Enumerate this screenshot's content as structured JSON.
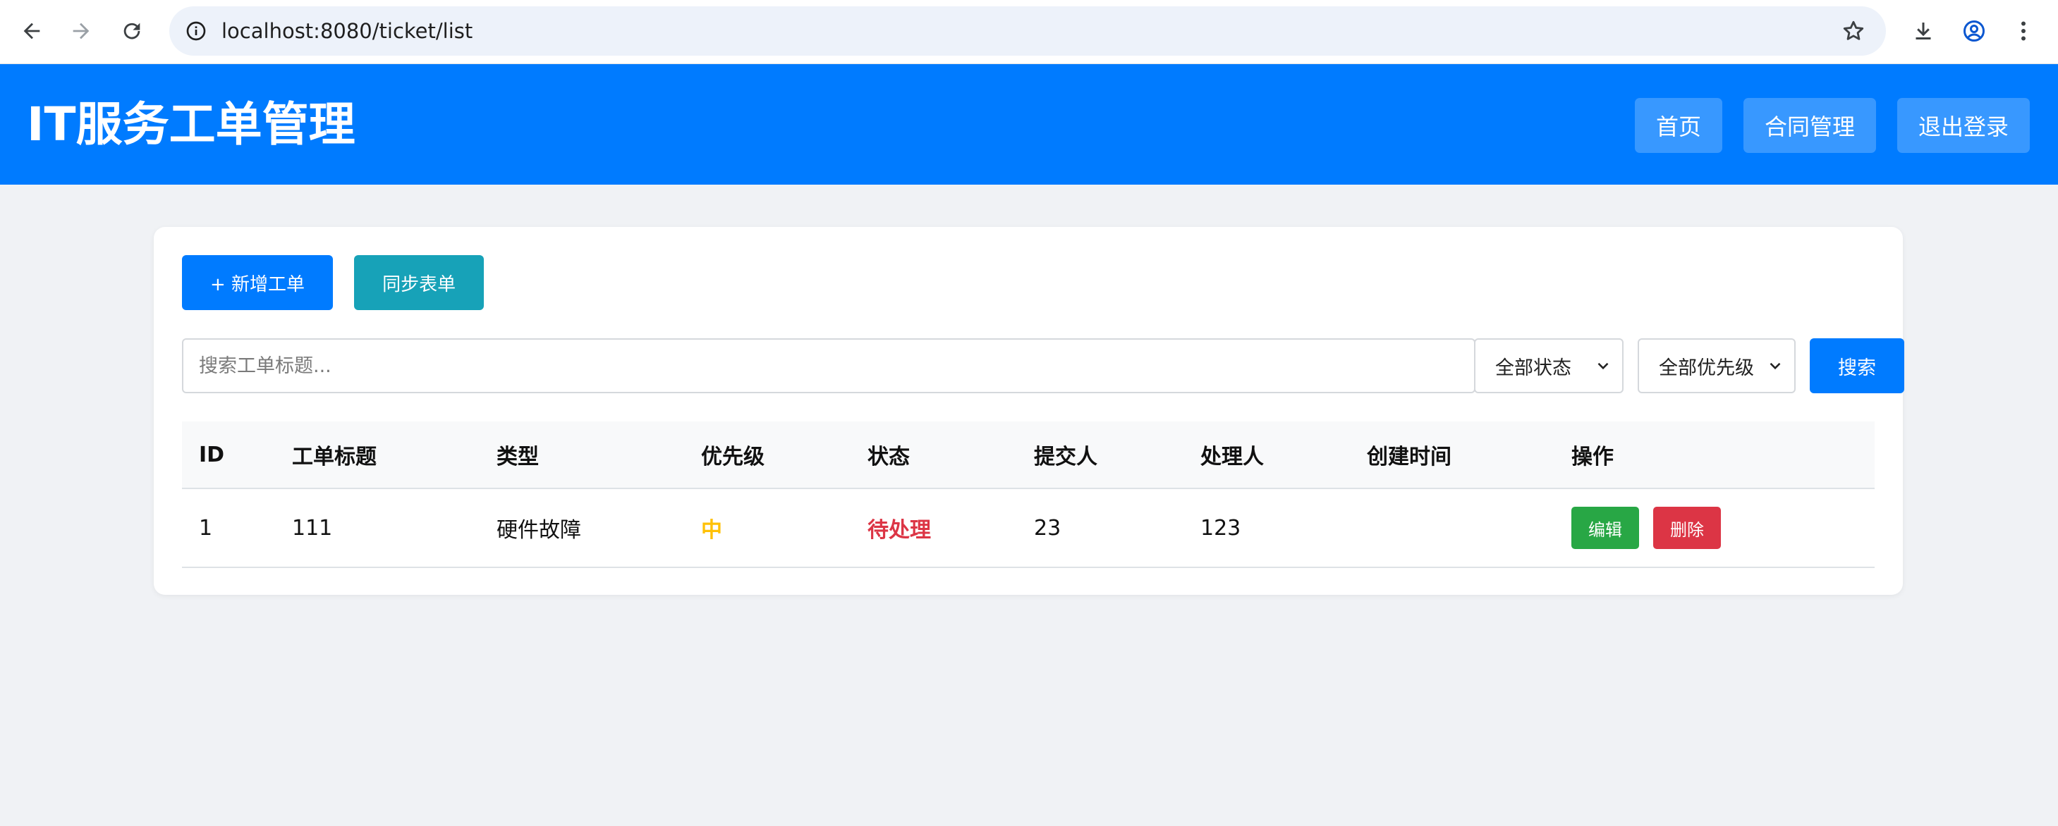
{
  "browser": {
    "url": "localhost:8080/ticket/list"
  },
  "header": {
    "title": "IT服务工单管理",
    "nav": {
      "home": "首页",
      "contracts": "合同管理",
      "logout": "退出登录"
    }
  },
  "toolbar": {
    "add_label": "+ 新增工单",
    "sync_label": "同步表单"
  },
  "search": {
    "placeholder": "搜索工单标题...",
    "value": "",
    "status_filter": "全部状态",
    "priority_filter": "全部优先级",
    "button_label": "搜索"
  },
  "table": {
    "headers": [
      "ID",
      "工单标题",
      "类型",
      "优先级",
      "状态",
      "提交人",
      "处理人",
      "创建时间",
      "操作"
    ],
    "rows": [
      {
        "id": "1",
        "title": "111",
        "type": "硬件故障",
        "priority": "中",
        "status": "待处理",
        "submitter": "23",
        "assignee": "123",
        "created_at": "",
        "edit_label": "编辑",
        "delete_label": "删除"
      }
    ]
  },
  "colors": {
    "primary": "#007bff",
    "info": "#17a2b8",
    "success": "#28a745",
    "danger": "#dc3545",
    "warning": "#ffc107"
  }
}
